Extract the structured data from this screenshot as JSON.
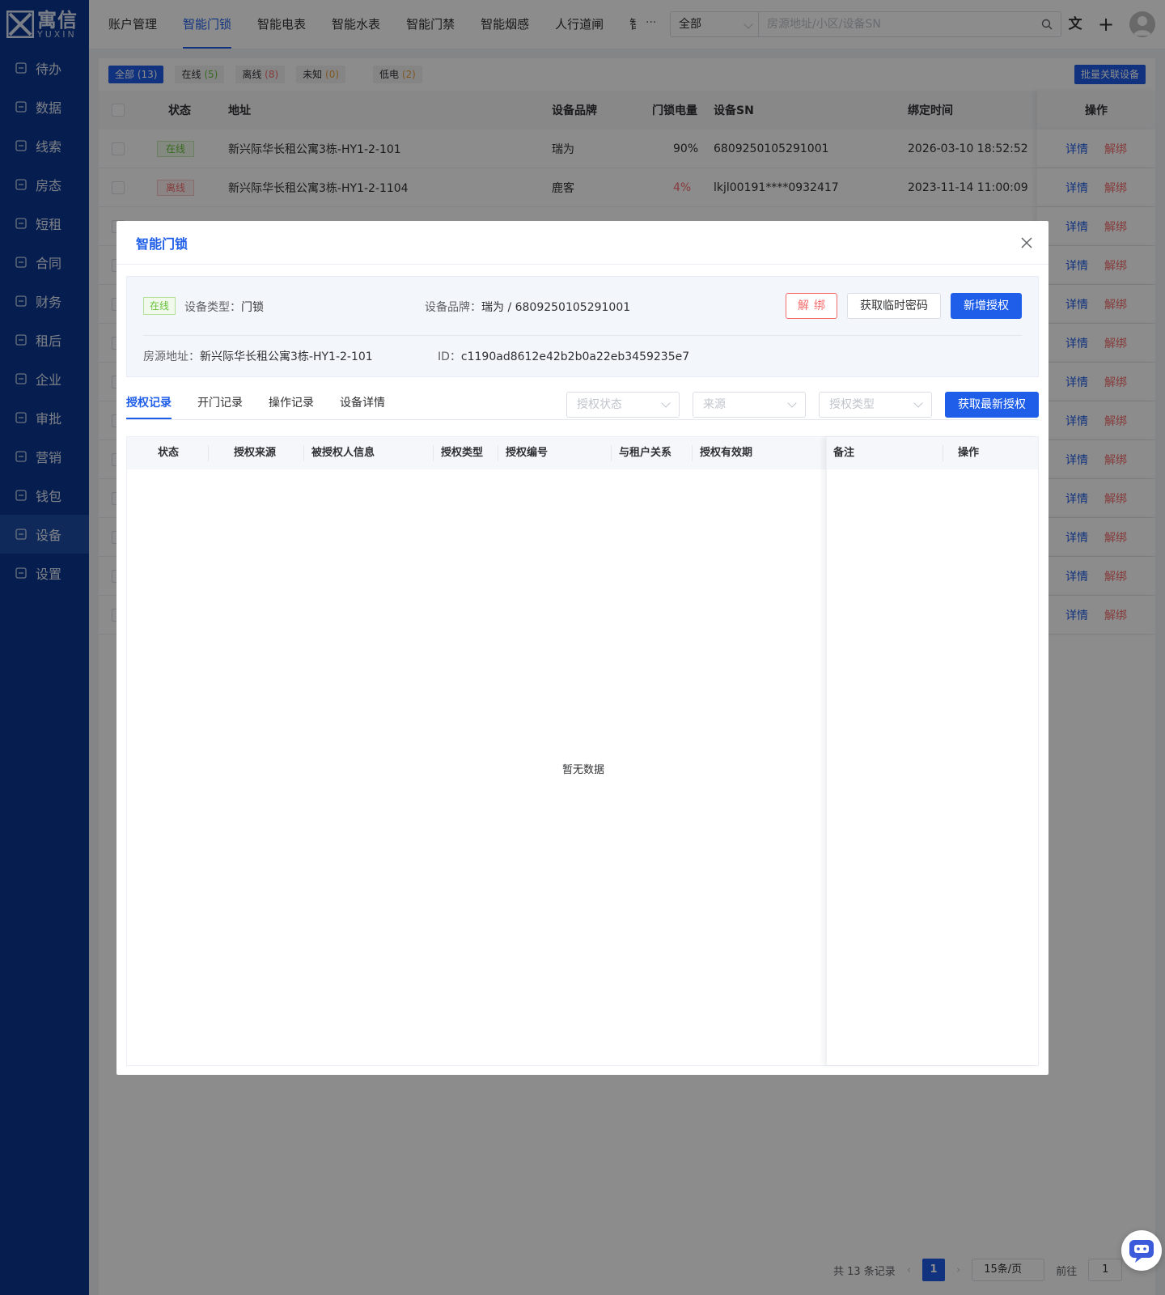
{
  "brand": {
    "cn": "寓信",
    "en": "YUXIN"
  },
  "sidebar": {
    "items": [
      {
        "label": "待办"
      },
      {
        "label": "数据"
      },
      {
        "label": "线索"
      },
      {
        "label": "房态"
      },
      {
        "label": "短租"
      },
      {
        "label": "合同"
      },
      {
        "label": "财务"
      },
      {
        "label": "租后"
      },
      {
        "label": "企业"
      },
      {
        "label": "审批"
      },
      {
        "label": "营销"
      },
      {
        "label": "钱包"
      },
      {
        "label": "设备"
      },
      {
        "label": "设置"
      }
    ],
    "active": "设备"
  },
  "topbar": {
    "tabs": [
      "账户管理",
      "智能门锁",
      "智能电表",
      "智能水表",
      "智能门禁",
      "智能烟感",
      "人行道闸",
      "智"
    ],
    "active_tab": "智能门锁",
    "more": "···",
    "scope_select": "全部",
    "search_placeholder": "房源地址/小区/设备SN"
  },
  "filters": {
    "all": "全部",
    "all_count": "(13)",
    "online": "在线",
    "online_count": "(5)",
    "offline": "离线",
    "offline_count": "(8)",
    "unknown": "未知",
    "unknown_count": "(0)",
    "lowpower": "低电",
    "lowpower_count": "(2)",
    "batch": "批量关联设备"
  },
  "list": {
    "headers": {
      "status": "状态",
      "address": "地址",
      "brand": "设备品牌",
      "battery": "门锁电量",
      "sn": "设备SN",
      "bind_time": "绑定时间",
      "op": "操作"
    },
    "rows": [
      {
        "status": "在线",
        "address": "新兴际华长租公寓3栋-HY1-2-101",
        "brand": "瑞为",
        "battery": "90%",
        "sn": "6809250105291001",
        "bind_time": "2026-03-10 18:52:52"
      },
      {
        "status": "离线",
        "address": "新兴际华长租公寓3栋-HY1-2-1104",
        "brand": "鹿客",
        "battery": "4%",
        "sn": "lkjl00191****0932417",
        "bind_time": "2023-11-14 11:00:09"
      }
    ],
    "detail": "详情",
    "unbind": "解绑"
  },
  "pager": {
    "total": "共 13 条记录",
    "page": "1",
    "size": "15条/页",
    "goto": "前往",
    "goto_value": "1",
    "unit": "页"
  },
  "dialog": {
    "title": "智能门锁",
    "status": "在线",
    "type_label": "设备类型：",
    "type_value": "门锁",
    "brand_label": "设备品牌：",
    "brand_value": "瑞为 / 6809250105291001",
    "addr_label": "房源地址：",
    "addr_value": "新兴际华长租公寓3栋-HY1-2-101",
    "id_label": "ID：",
    "id_value": "c1190ad8612e42b2b0a22eb3459235e7",
    "btn_unbind": "解绑",
    "btn_temp_pwd": "获取临时密码",
    "btn_add_auth": "新增授权",
    "tabs": [
      "授权记录",
      "开门记录",
      "操作记录",
      "设备详情"
    ],
    "active_tab": "授权记录",
    "filter_status": "授权状态",
    "filter_source": "来源",
    "filter_type": "授权类型",
    "btn_fetch": "获取最新授权",
    "columns": [
      "状态",
      "授权来源",
      "被授权人信息",
      "授权类型",
      "授权编号",
      "与租户关系",
      "授权有效期",
      "备注",
      "操作"
    ],
    "empty": "暂无数据"
  },
  "colors": {
    "primary": "#1f5ee8",
    "sidebar": "#0a3590",
    "success": "#67c23a",
    "danger": "#f56c6c",
    "warning": "#e6a23c"
  }
}
